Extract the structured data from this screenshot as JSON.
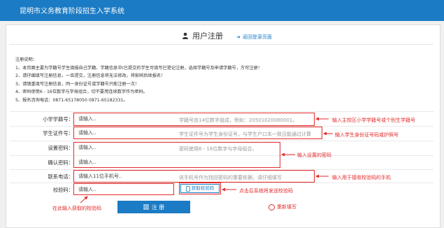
{
  "header": {
    "title": "昆明市义务教育阶段招生入学系统"
  },
  "page": {
    "subtitle": "用户注册",
    "back_link": "返回登录页面"
  },
  "notes": {
    "heading": "注册说明：",
    "lines": [
      "1、本页面主要为学籍号学生填报自己学籍、学籍信息中(已提交的学生可填写已登记注册，选择学籍号及申请学籍号，方可注册！",
      "2、请仔细填写注册信息，一旦提交，注册信息将无法修改，将影响后续报名！",
      "3、请慎重填写注册信息，同一身份证号或学籍号只能注册一次！",
      "4、密码使用6 - 16位数字与字母组合，切不要用连续数字作为密码。",
      "5、报名咨询电话：0871-65178050 0871-65182331。"
    ]
  },
  "form": {
    "student_id": {
      "label": "小学学籍号：",
      "placeholder": "请输入..",
      "hint": "学籍号由14位数字组成，例如：20501020080001。",
      "note": "输入主校区小学学籍号或个别生学籍号"
    },
    "id_card": {
      "label": "学生证件号：",
      "placeholder": "请输入..",
      "hint": "学生证件号为学生身份证号，与学生户口本一致且能通过计算",
      "note": "输入学生身份证号码或护照号"
    },
    "password": {
      "label": "设置密码：",
      "placeholder": "请输入..",
      "hint": "密码使用6 - 16位数字与字母组合。"
    },
    "confirm_password": {
      "label": "确认密码：",
      "placeholder": "请输入.."
    },
    "phone": {
      "label": "联系电话：",
      "placeholder": "请输入11位手机号..",
      "hint": "该手机号作为找回密码的重要依据，请仔细填写",
      "note": "输入用于接收校验码的手机"
    },
    "verify_code": {
      "label": "校验码：",
      "placeholder": "请输入..",
      "get_code_button": "获取校验码",
      "note": "在此输入获取的校验码",
      "note2": "点击后系统将发送校验码"
    }
  },
  "password_note": "输入设置的密码",
  "buttons": {
    "submit": "注 册",
    "reset": "重新填写"
  }
}
